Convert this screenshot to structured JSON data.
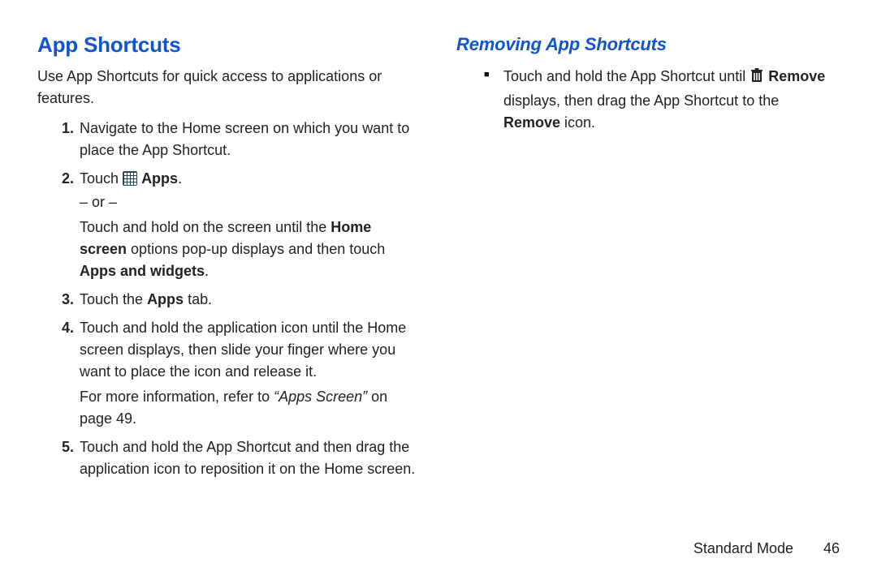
{
  "left": {
    "title": "App Shortcuts",
    "intro": "Use App Shortcuts for quick access to applications or features.",
    "step1": "Navigate to the Home screen on which you want to place the App Shortcut.",
    "step2_pre": "Touch ",
    "step2_bold": "Apps",
    "step2_post": ".",
    "step2_or": "– or –",
    "step2b_pre": "Touch and hold on the screen until the ",
    "step2b_b1": "Home screen",
    "step2b_mid": " options pop-up displays and then touch ",
    "step2b_b2": "Apps and widgets",
    "step2b_post": ".",
    "step3_pre": "Touch the ",
    "step3_bold": "Apps",
    "step3_post": " tab.",
    "step4_a": "Touch and hold the application icon until the Home screen displays, then slide your finger where you want to place the icon and release it.",
    "step4_ref_pre": "For more information, refer to ",
    "step4_ref_italic": "“Apps Screen”",
    "step4_ref_post": " on page 49.",
    "step5": "Touch and hold the App Shortcut and then drag the application icon to reposition it on the Home screen."
  },
  "right": {
    "title": "Removing App Shortcuts",
    "b1_pre": "Touch and hold the App Shortcut until ",
    "b1_bold1": "Remove",
    "b1_mid": " displays, then drag the App Shortcut to the ",
    "b1_bold2": "Remove",
    "b1_post": " icon."
  },
  "footer": {
    "section": "Standard Mode",
    "page": "46"
  }
}
